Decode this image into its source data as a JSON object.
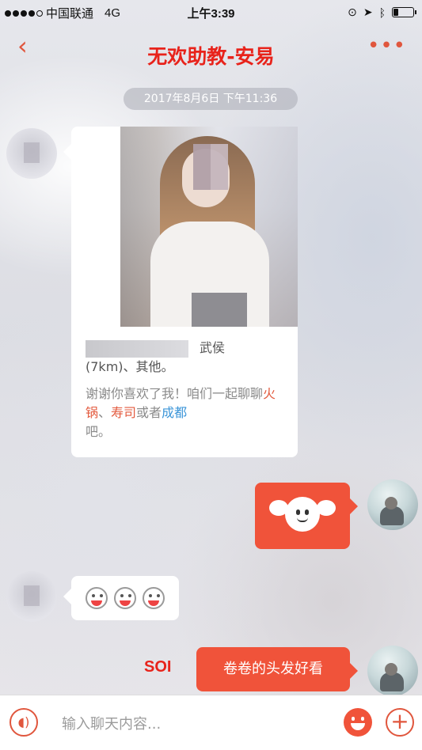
{
  "status_bar": {
    "carrier": "中国联通",
    "network": "4G",
    "time": "上午3:39",
    "battery_level": 0.25
  },
  "nav": {
    "back_icon": "chevron-left-icon",
    "title": "无欢助教-安易",
    "more_icon": "more-dots-icon",
    "more_glyph": "•••"
  },
  "chat": {
    "timestamp": "2017年8月6日 下午11:36",
    "profile_card": {
      "location": "武侯",
      "distance_line": "(7km)、其他。",
      "desc_prefix": "谢谢你喜欢了我！咱们一起聊聊",
      "tag1": "火锅",
      "sep": "、",
      "tag2": "寿司",
      "or": "或者",
      "tag3": "成都",
      "desc_suffix": "吧。"
    },
    "sticker_icon": "winged-ghost-sticker",
    "emoji_icon": "grin-emoji-icon",
    "outgoing_text": "卷卷的头发好看",
    "annotation": "SOI"
  },
  "input_bar": {
    "voice_icon": "voice-icon",
    "placeholder": "输入聊天内容...",
    "emoji_icon": "emoji-icon",
    "plus_icon": "plus-icon",
    "plus_glyph": "+"
  },
  "colors": {
    "accent": "#f0533a",
    "title_red": "#e8231b",
    "link_blue": "#3b95d8"
  }
}
